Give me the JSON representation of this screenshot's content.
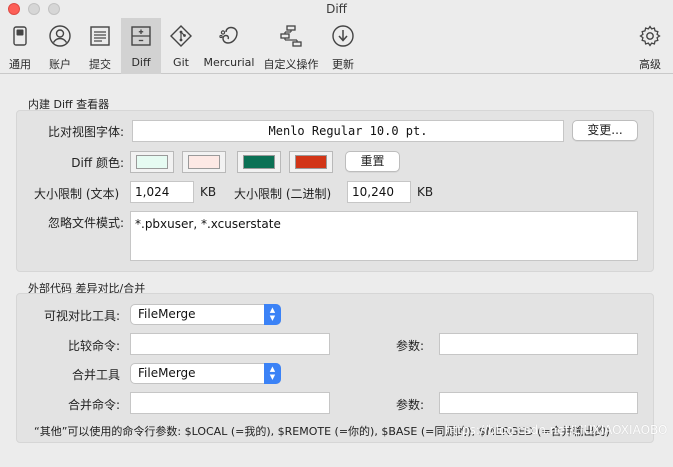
{
  "window": {
    "title": "Diff"
  },
  "toolbar": {
    "items": [
      {
        "label": "通用",
        "icon": "toggle-switch-icon"
      },
      {
        "label": "账户",
        "icon": "user-icon"
      },
      {
        "label": "提交",
        "icon": "document-icon"
      },
      {
        "label": "Diff",
        "icon": "diff-icon",
        "selected": true
      },
      {
        "label": "Git",
        "icon": "git-icon"
      },
      {
        "label": "Mercurial",
        "icon": "mercurial-icon"
      },
      {
        "label": "自定义操作",
        "icon": "custom-actions-icon"
      },
      {
        "label": "更新",
        "icon": "download-icon"
      },
      {
        "label": "高级",
        "icon": "gear-icon"
      }
    ]
  },
  "builtin": {
    "section_title": "内建 Diff 查看器",
    "font_label": "比对视图字体:",
    "font_value": "Menlo Regular 10.0 pt.",
    "change_button": "变更...",
    "colors_label": "Diff 颜色:",
    "colors": [
      "#e6fbf2",
      "#fde9e5",
      "#0b7155",
      "#d23517"
    ],
    "reset_button": "重置",
    "size_text_label": "大小限制 (文本)",
    "size_text_value": "1,024",
    "size_text_unit": "KB",
    "size_binary_label": "大小限制 (二进制)",
    "size_binary_value": "10,240",
    "size_binary_unit": "KB",
    "ignore_label": "忽略文件模式:",
    "ignore_value": "*.pbxuser, *.xcuserstate"
  },
  "external": {
    "section_title": "外部代码 差异对比/合并",
    "visual_tool_label": "可视对比工具:",
    "visual_tool_value": "FileMerge",
    "compare_cmd_label": "比较命令:",
    "compare_cmd_value": "",
    "compare_args_label": "参数:",
    "compare_args_value": "",
    "merge_tool_label": "合并工具",
    "merge_tool_value": "FileMerge",
    "merge_cmd_label": "合并命令:",
    "merge_cmd_value": "",
    "merge_args_label": "参数:",
    "merge_args_value": "",
    "footnote": "“其他”可以使用的命令行参数: $LOCAL (=我的), $REMOTE (=你的), $BASE (=同源的), $MERGED (=合并输出的)"
  },
  "watermark": "https://blog.csdn.net/LIUXIAOXIAOBO"
}
